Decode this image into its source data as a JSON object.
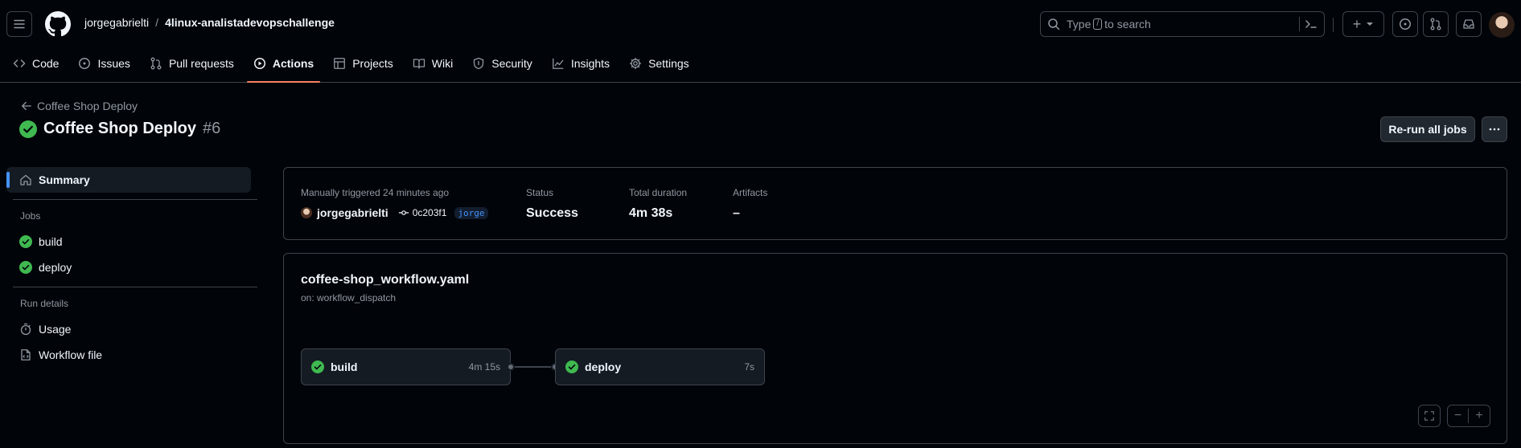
{
  "header": {
    "owner": "jorgegabrielti",
    "separator": "/",
    "repo": "4linux-analistadevopschallenge",
    "search": {
      "prefix": "Type",
      "key": "/",
      "suffix": "to search"
    },
    "create_label": "+"
  },
  "nav": {
    "tabs": [
      {
        "label": "Code",
        "icon": "code-icon"
      },
      {
        "label": "Issues",
        "icon": "issue-icon"
      },
      {
        "label": "Pull requests",
        "icon": "pull-request-icon"
      },
      {
        "label": "Actions",
        "icon": "play-icon",
        "selected": true
      },
      {
        "label": "Projects",
        "icon": "table-icon"
      },
      {
        "label": "Wiki",
        "icon": "book-icon"
      },
      {
        "label": "Security",
        "icon": "shield-icon"
      },
      {
        "label": "Insights",
        "icon": "graph-icon"
      },
      {
        "label": "Settings",
        "icon": "gear-icon"
      }
    ]
  },
  "run": {
    "back_label": "Coffee Shop Deploy",
    "title": "Coffee Shop Deploy",
    "number": "#6",
    "rerun_label": "Re-run all jobs"
  },
  "sidebar": {
    "summary_label": "Summary",
    "jobs_heading": "Jobs",
    "jobs": [
      {
        "label": "build"
      },
      {
        "label": "deploy"
      }
    ],
    "run_details_heading": "Run details",
    "usage_label": "Usage",
    "workflow_file_label": "Workflow file"
  },
  "summary": {
    "trigger_label": "Manually triggered 24 minutes ago",
    "actor": "jorgegabrielti",
    "commit": "0c203f1",
    "branch": "jorge",
    "status_label": "Status",
    "status_value": "Success",
    "duration_label": "Total duration",
    "duration_value": "4m 38s",
    "artifacts_label": "Artifacts",
    "artifacts_value": "–"
  },
  "workflow": {
    "file": "coffee-shop_workflow.yaml",
    "trigger": "on: workflow_dispatch",
    "jobs": [
      {
        "name": "build",
        "duration": "4m 15s"
      },
      {
        "name": "deploy",
        "duration": "7s"
      }
    ]
  },
  "colors": {
    "accent": "#f78166",
    "success": "#3fb950",
    "link": "#4493f8",
    "background": "#010409",
    "border": "#3d444d"
  }
}
